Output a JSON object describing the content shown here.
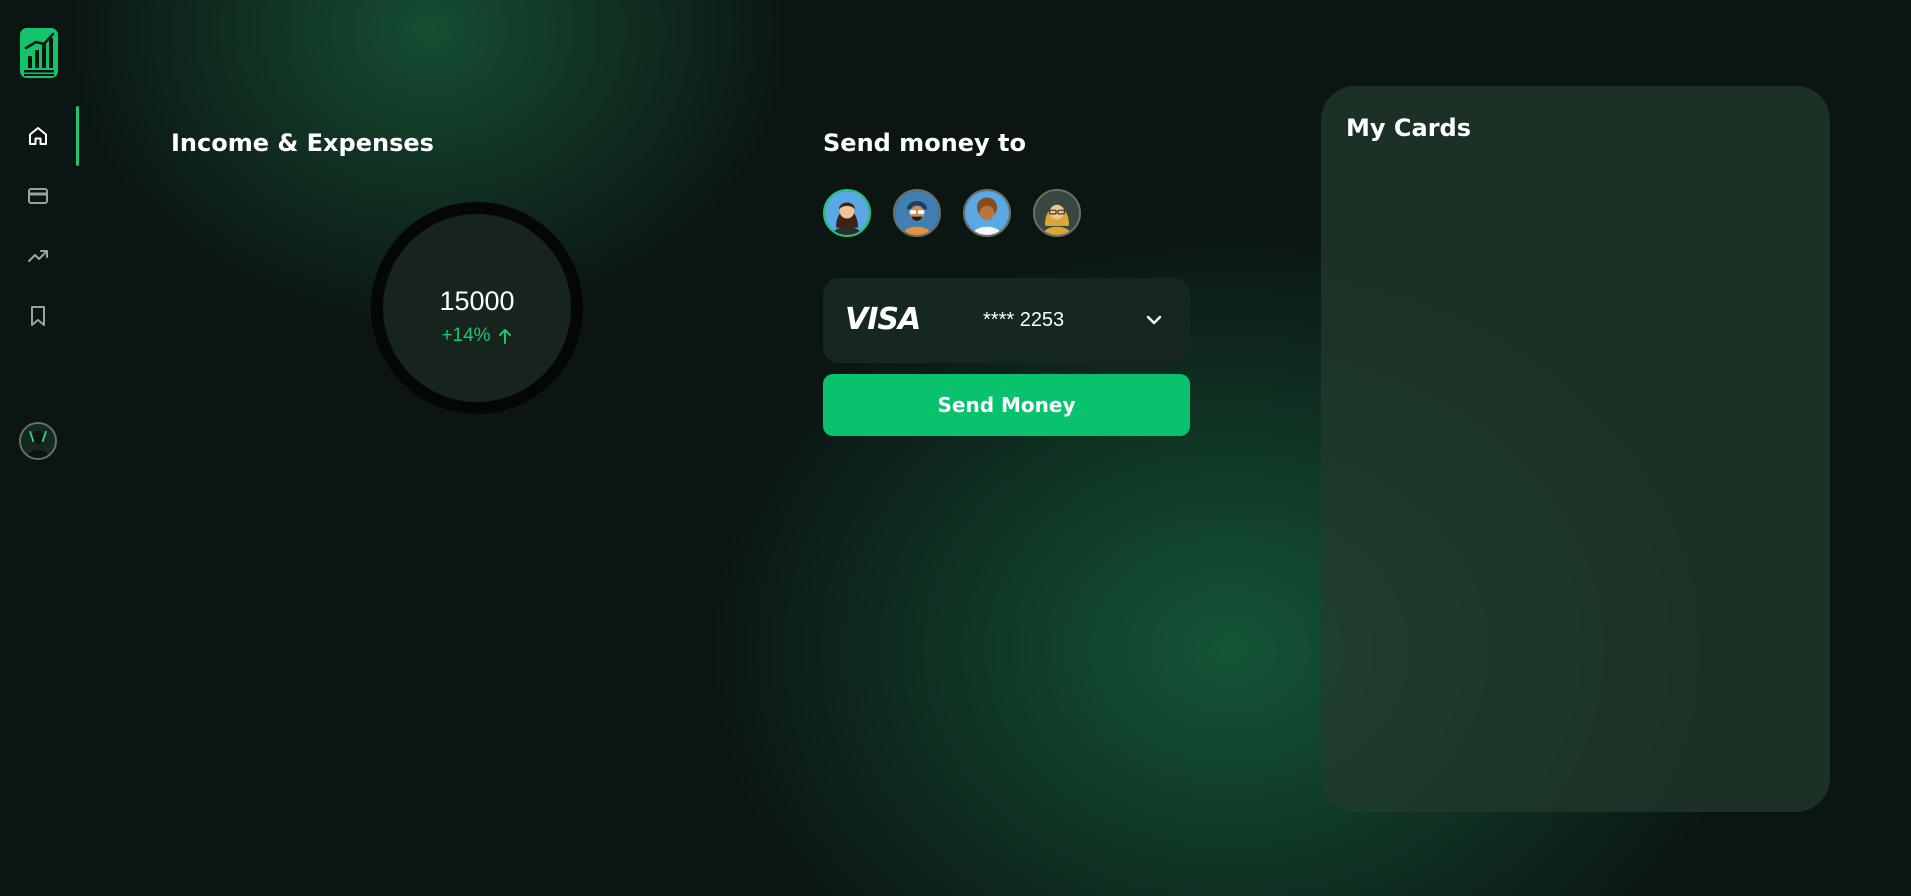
{
  "colors": {
    "background": "#0b1612",
    "accent": "#1fc56f",
    "button": "#08c26e",
    "panel": "#16271f"
  },
  "sidebar": {
    "logo_icon": "bar-chart-logo-icon",
    "items": [
      {
        "icon": "home-icon",
        "active": true
      },
      {
        "icon": "credit-card-icon",
        "active": false
      },
      {
        "icon": "trending-up-icon",
        "active": false
      },
      {
        "icon": "bookmark-icon",
        "active": false
      }
    ],
    "user_avatar_icon": "user-avatar"
  },
  "income": {
    "title": "Income & Expenses",
    "value": "15000",
    "change": "+14%",
    "change_icon": "arrow-up-icon"
  },
  "send_money": {
    "title": "Send money to",
    "recipients": [
      {
        "avatar": "woman-avatar",
        "selected": true
      },
      {
        "avatar": "man-glasses-avatar",
        "selected": false
      },
      {
        "avatar": "curly-hair-avatar",
        "selected": false
      },
      {
        "avatar": "blonde-glasses-avatar",
        "selected": false
      }
    ],
    "card": {
      "brand": "VISA",
      "number": "**** 2253",
      "dropdown_icon": "chevron-down-icon"
    },
    "button_label": "Send Money"
  },
  "my_cards": {
    "title": "My Cards"
  }
}
